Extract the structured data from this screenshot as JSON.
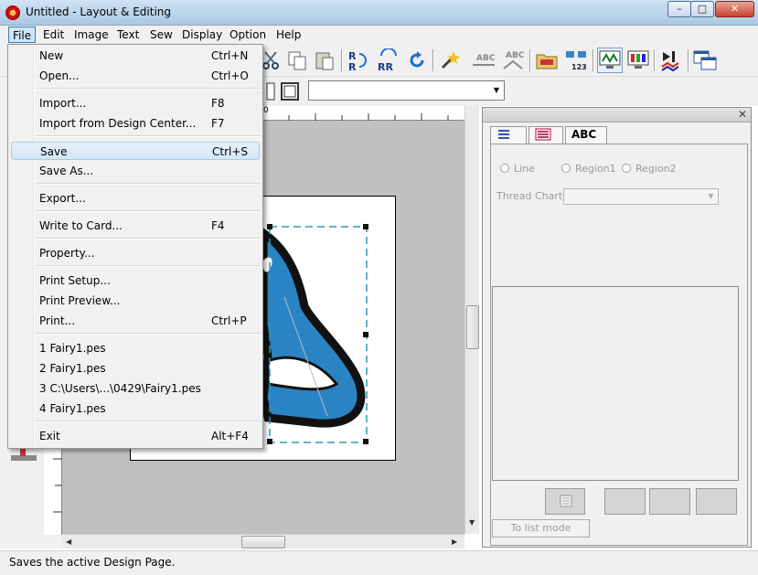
{
  "window": {
    "title": "Untitled - Layout & Editing",
    "min": "–",
    "max": "□",
    "close": "✕"
  },
  "menubar": [
    {
      "label": "File"
    },
    {
      "label": "Edit"
    },
    {
      "label": "Image"
    },
    {
      "label": "Text"
    },
    {
      "label": "Sew"
    },
    {
      "label": "Display"
    },
    {
      "label": "Option"
    },
    {
      "label": "Help"
    }
  ],
  "file_menu": {
    "items": [
      {
        "label": "New",
        "shortcut": "Ctrl+N"
      },
      {
        "label": "Open...",
        "shortcut": "Ctrl+O"
      },
      {
        "label": "Import...",
        "shortcut": "F8"
      },
      {
        "label": "Import from Design Center...",
        "shortcut": "F7"
      },
      {
        "label": "Save",
        "shortcut": "Ctrl+S"
      },
      {
        "label": "Save As...",
        "shortcut": ""
      },
      {
        "label": "Export...",
        "shortcut": ""
      },
      {
        "label": "Write to Card...",
        "shortcut": "F4"
      },
      {
        "label": "Property...",
        "shortcut": ""
      },
      {
        "label": "Print Setup...",
        "shortcut": ""
      },
      {
        "label": "Print Preview...",
        "shortcut": ""
      },
      {
        "label": "Print...",
        "shortcut": "Ctrl+P"
      },
      {
        "label": "1 Fairy1.pes",
        "shortcut": ""
      },
      {
        "label": "2 Fairy1.pes",
        "shortcut": ""
      },
      {
        "label": "3 C:\\Users\\...\\0429\\Fairy1.pes",
        "shortcut": ""
      },
      {
        "label": "4 Fairy1.pes",
        "shortcut": ""
      },
      {
        "label": "Exit",
        "shortcut": "Alt+F4"
      }
    ],
    "highlighted": "Save"
  },
  "toolbar": {
    "abc_label": "ABC",
    "counter_label": "123"
  },
  "ruler": {
    "origin_label": "0"
  },
  "right_panel": {
    "tab_text": "ABC",
    "radio_line": "Line",
    "radio_region1": "Region1",
    "radio_region2": "Region2",
    "thread_chart_label": "Thread Chart:",
    "list_mode_button": "To list mode"
  },
  "status": {
    "text": "Saves the active Design Page."
  },
  "colors": {
    "accent": "#3c7fb1",
    "design_blue": "#2a84c4",
    "design_outline": "#111111"
  }
}
